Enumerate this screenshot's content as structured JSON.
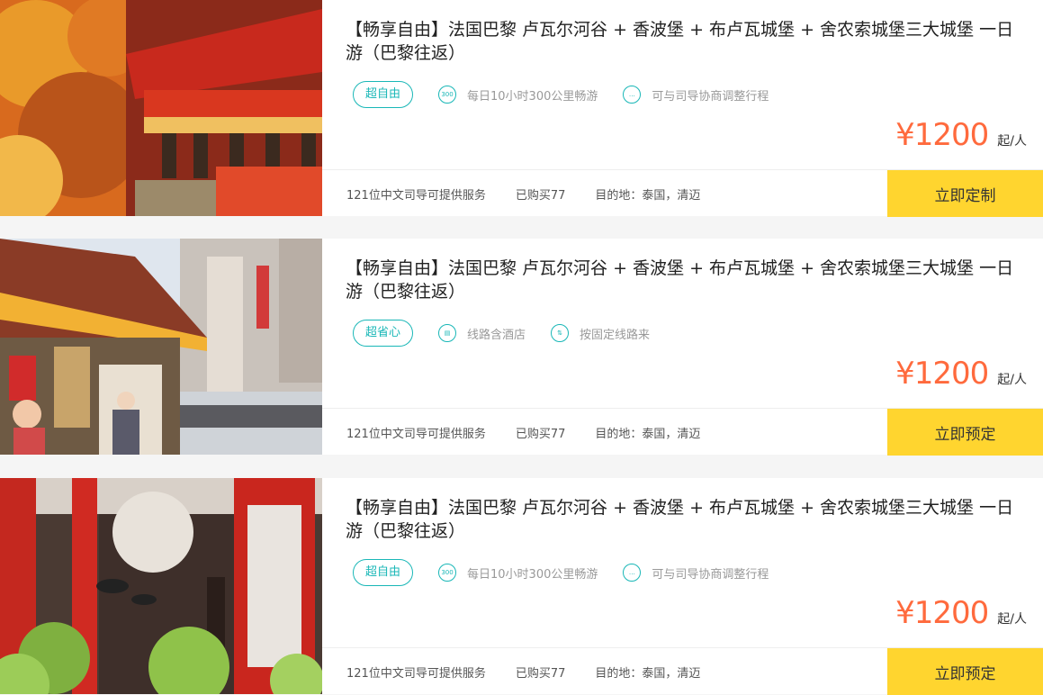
{
  "cards": [
    {
      "title": "【畅享自由】法国巴黎 卢瓦尔河谷 + 香波堡 + 布卢瓦城堡 + 舍农索城堡三大城堡 一日游（巴黎往返）",
      "tag": "超自由",
      "features": [
        {
          "icon": "300-icon",
          "icon_text": "300",
          "label": "每日10小时300公里畅游"
        },
        {
          "icon": "chat-icon",
          "icon_text": "…",
          "label": "可与司导协商调整行程"
        }
      ],
      "price": "¥1200",
      "price_unit": "起/人",
      "guides": "121位中文司导可提供服务",
      "purchased": "已购买77",
      "destination": "目的地：泰国，清迈",
      "cta": "立即定制"
    },
    {
      "title": "【畅享自由】法国巴黎 卢瓦尔河谷 + 香波堡 + 布卢瓦城堡 + 舍农索城堡三大城堡 一日游（巴黎往返）",
      "tag": "超省心",
      "features": [
        {
          "icon": "hotel-icon",
          "icon_text": "▤",
          "label": "线路含酒店"
        },
        {
          "icon": "route-icon",
          "icon_text": "⇅",
          "label": "按固定线路来"
        }
      ],
      "price": "¥1200",
      "price_unit": "起/人",
      "guides": "121位中文司导可提供服务",
      "purchased": "已购买77",
      "destination": "目的地：泰国，清迈",
      "cta": "立即预定"
    },
    {
      "title": "【畅享自由】法国巴黎 卢瓦尔河谷 + 香波堡 + 布卢瓦城堡 + 舍农索城堡三大城堡 一日游（巴黎往返）",
      "tag": "超自由",
      "features": [
        {
          "icon": "300-icon",
          "icon_text": "300",
          "label": "每日10小时300公里畅游"
        },
        {
          "icon": "chat-icon",
          "icon_text": "…",
          "label": "可与司导协商调整行程"
        }
      ],
      "price": "¥1200",
      "price_unit": "起/人",
      "guides": "121位中文司导可提供服务",
      "purchased": "已购买77",
      "destination": "目的地：泰国，清迈",
      "cta": "立即预定"
    }
  ],
  "colors": {
    "accent": "#19b7b7",
    "price": "#ff6a3d",
    "cta": "#ffd52f"
  }
}
